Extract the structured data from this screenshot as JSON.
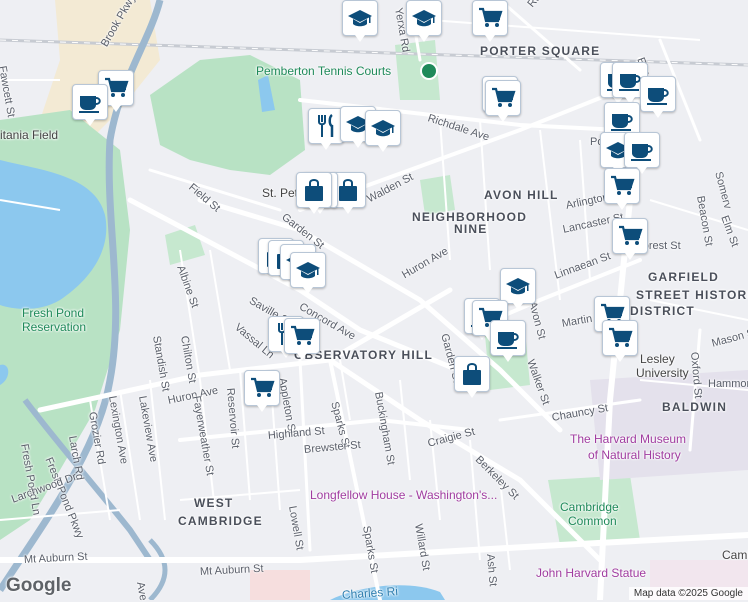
{
  "map": {
    "copyright": "Map data ©2025 Google",
    "logo": "Google",
    "colors": {
      "water": "#8cc8ee",
      "park": "#b8e2c4",
      "road": "#ffffff",
      "land": "#eeeff3",
      "marker_icon": "#0d4d7a",
      "highway": "#9db8cf"
    },
    "areas": [
      {
        "text": "PORTER SQUARE"
      },
      {
        "text": "AVON HILL"
      },
      {
        "text": "NEIGHBORHOOD"
      },
      {
        "text": "NINE"
      },
      {
        "text": "GARFIELD"
      },
      {
        "text": "STREET HISTORIC"
      },
      {
        "text": "DISTRICT"
      },
      {
        "text": "OBSERVATORY HILL"
      },
      {
        "text": "BALDWIN"
      },
      {
        "text": "WEST"
      },
      {
        "text": "CAMBRIDGE"
      }
    ],
    "pois": [
      {
        "text": "Pemberton Tennis Courts"
      },
      {
        "text": "Fresh Pond"
      },
      {
        "text": "Reservation"
      },
      {
        "text": "The Harvard Museum"
      },
      {
        "text": "of Natural History"
      },
      {
        "text": "Longfellow House - Washington's..."
      },
      {
        "text": "Cambridge"
      },
      {
        "text": "Common"
      },
      {
        "text": "John Harvard Statue"
      },
      {
        "text": "St. Pete"
      },
      {
        "text": "Lesley"
      },
      {
        "text": "University"
      },
      {
        "text": "itania Field"
      },
      {
        "text": "Camb"
      },
      {
        "text": "Charles Ri"
      }
    ],
    "streets": [
      {
        "text": "Fawcett St"
      },
      {
        "text": "Yerxa Rd"
      },
      {
        "text": "Russell St"
      },
      {
        "text": "Elm St"
      },
      {
        "text": "Richdale Ave"
      },
      {
        "text": "Walden St"
      },
      {
        "text": "Field St"
      },
      {
        "text": "Garden St"
      },
      {
        "text": "Arlington St"
      },
      {
        "text": "Lancaster St"
      },
      {
        "text": "Forest St"
      },
      {
        "text": "Linnaean St"
      },
      {
        "text": "Huron Ave"
      },
      {
        "text": "Huron Ave"
      },
      {
        "text": "Albine St"
      },
      {
        "text": "Saville St"
      },
      {
        "text": "Concord Ave"
      },
      {
        "text": "Vassal Ln"
      },
      {
        "text": "Avon St"
      },
      {
        "text": "Martin St"
      },
      {
        "text": "Garden St"
      },
      {
        "text": "Walker St"
      },
      {
        "text": "Standish St"
      },
      {
        "text": "Chilton St"
      },
      {
        "text": "Reservoir St"
      },
      {
        "text": "Appleton St"
      },
      {
        "text": "Sparks St"
      },
      {
        "text": "Buckingham St"
      },
      {
        "text": "Lakeview Ave"
      },
      {
        "text": "Lexington Ave"
      },
      {
        "text": "Grozier Rd"
      },
      {
        "text": "Larch Rd"
      },
      {
        "text": "Fayerweather St"
      },
      {
        "text": "Highland St"
      },
      {
        "text": "Brewster St"
      },
      {
        "text": "Craigie St"
      },
      {
        "text": "Berkeley St"
      },
      {
        "text": "Chauncy St"
      },
      {
        "text": "Oxford St"
      },
      {
        "text": "Hammond"
      },
      {
        "text": "Fresh Pond Pkwy"
      },
      {
        "text": "Fresh Pond Ln"
      },
      {
        "text": "Larchwood Dr"
      },
      {
        "text": "Lowell St"
      },
      {
        "text": "Sparks St"
      },
      {
        "text": "Willard St"
      },
      {
        "text": "Ash St"
      },
      {
        "text": "Mt Auburn St"
      },
      {
        "text": "Mt Auburn St"
      },
      {
        "text": "Mason St"
      },
      {
        "text": "Somerv"
      },
      {
        "text": "Beacon St"
      },
      {
        "text": "Elm St"
      },
      {
        "text": "Porter"
      },
      {
        "text": "Ave"
      },
      {
        "text": "Brook Pkwy"
      }
    ],
    "markers": [
      {
        "icon": "education-icon"
      },
      {
        "icon": "education-icon"
      },
      {
        "icon": "shopping-cart-icon"
      },
      {
        "icon": "shopping-cart-icon"
      },
      {
        "icon": "cafe-icon"
      },
      {
        "icon": "shopping-cart-icon"
      },
      {
        "icon": "cafe-icon"
      },
      {
        "icon": "cafe-icon"
      },
      {
        "icon": "shopping-cart-icon"
      },
      {
        "icon": "cafe-icon"
      },
      {
        "icon": "cafe-icon"
      },
      {
        "icon": "restaurant-icon"
      },
      {
        "icon": "education-icon"
      },
      {
        "icon": "education-icon"
      },
      {
        "icon": "education-icon"
      },
      {
        "icon": "shopping-bag-icon"
      },
      {
        "icon": "cafe-icon"
      },
      {
        "icon": "shopping-cart-icon"
      },
      {
        "icon": "shopping-bag-icon"
      },
      {
        "icon": "shopping-cart-icon"
      },
      {
        "icon": "shopping-bag-icon"
      },
      {
        "icon": "shopping-bag-icon"
      },
      {
        "icon": "shopping-bag-icon"
      },
      {
        "icon": "education-icon"
      },
      {
        "icon": "education-icon"
      },
      {
        "icon": "education-icon"
      },
      {
        "icon": "cafe-icon"
      },
      {
        "icon": "shopping-cart-icon"
      },
      {
        "icon": "cafe-icon"
      },
      {
        "icon": "shopping-cart-icon"
      },
      {
        "icon": "restaurant-icon"
      },
      {
        "icon": "shopping-cart-icon"
      },
      {
        "icon": "shopping-bag-icon"
      },
      {
        "icon": "shopping-cart-icon"
      },
      {
        "icon": "shopping-cart-icon"
      }
    ]
  }
}
